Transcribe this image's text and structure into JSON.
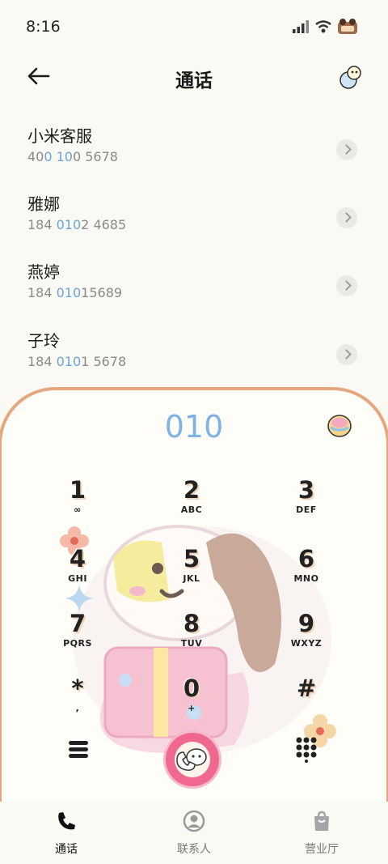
{
  "status": {
    "time": "8:16"
  },
  "header": {
    "title": "通话"
  },
  "contacts": [
    {
      "name": "小米客服",
      "num_a": "40",
      "num_b": "0 10",
      "num_c": "0 5678"
    },
    {
      "name": "雅娜",
      "num_a": "184 ",
      "num_b": "010",
      "num_c": "2 4685"
    },
    {
      "name": "燕婷",
      "num_a": "184 ",
      "num_b": "010",
      "num_c": "15689"
    },
    {
      "name": "子玲",
      "num_a": "184 ",
      "num_b": "010",
      "num_c": "1 5678"
    }
  ],
  "dialer": {
    "input": "010"
  },
  "keys": [
    {
      "digit": "1",
      "letters": "∞"
    },
    {
      "digit": "2",
      "letters": "ABC"
    },
    {
      "digit": "3",
      "letters": "DEF"
    },
    {
      "digit": "4",
      "letters": "GHI"
    },
    {
      "digit": "5",
      "letters": "JKL"
    },
    {
      "digit": "6",
      "letters": "MNO"
    },
    {
      "digit": "7",
      "letters": "PQRS"
    },
    {
      "digit": "8",
      "letters": "TUV"
    },
    {
      "digit": "9",
      "letters": "WXYZ"
    },
    {
      "digit": "*",
      "letters": ","
    },
    {
      "digit": "0",
      "letters": "+"
    },
    {
      "digit": "#",
      "letters": ""
    }
  ],
  "tabs": [
    {
      "label": "通话",
      "icon": "phone-icon",
      "active": true
    },
    {
      "label": "联系人",
      "icon": "person-icon",
      "active": false
    },
    {
      "label": "营业厅",
      "icon": "bag-icon",
      "active": false
    }
  ],
  "colors": {
    "accent": "#6aa5d9",
    "call": "#f0688f",
    "panel_border": "#e5a77f"
  }
}
